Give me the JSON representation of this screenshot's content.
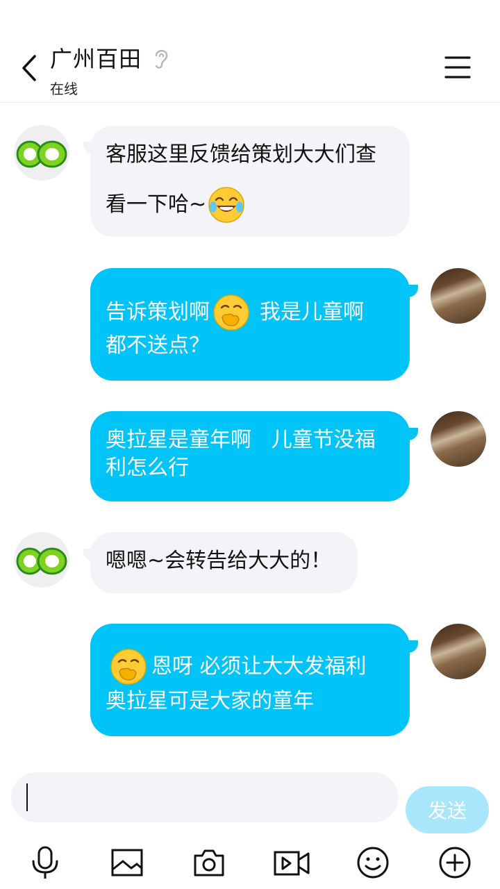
{
  "header": {
    "title": "广州百田",
    "status": "在线"
  },
  "messages": [
    {
      "side": "in",
      "lines": [
        "客服这里反馈给策划大大们查",
        "看一下哈~"
      ],
      "emoji": "laughing-tears"
    },
    {
      "side": "out",
      "text_before": "告诉策划啊",
      "emoji": "hand-over-mouth",
      "text_after": "我是儿童啊",
      "line2": "都不送点？"
    },
    {
      "side": "out",
      "lines": [
        "奥拉星是童年啊   儿童节没福",
        "利怎么行"
      ]
    },
    {
      "side": "in",
      "text": "嗯嗯~会转告给大大的！"
    },
    {
      "side": "out",
      "emoji": "hand-over-mouth",
      "text_after": "恩呀 必须让大大发福利",
      "line2": "奥拉星可是大家的童年"
    }
  ],
  "input": {
    "value": "",
    "send_label": "发送"
  },
  "toolbar": [
    "microphone-icon",
    "image-icon",
    "camera-icon",
    "video-icon",
    "emoji-icon",
    "plus-icon"
  ],
  "colors": {
    "outgoing_bubble": "#00c3f7",
    "incoming_bubble": "#f3f4f8",
    "send_button": "#a8e6fb"
  }
}
